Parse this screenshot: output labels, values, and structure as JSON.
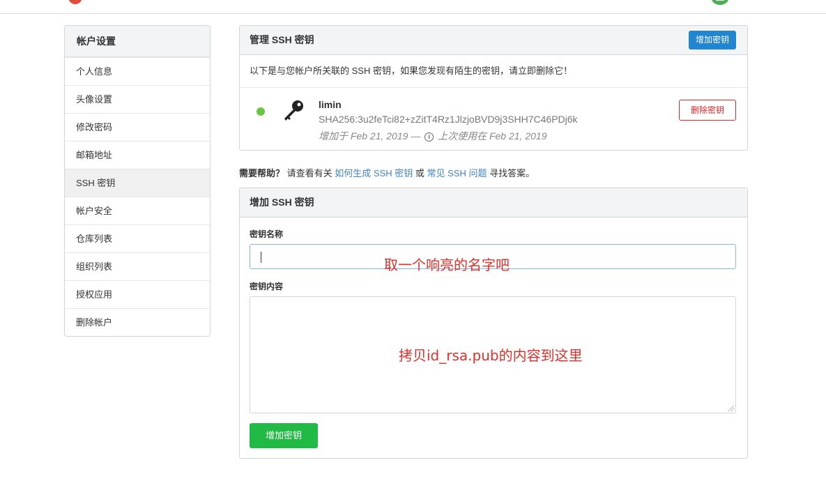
{
  "sidebar": {
    "title": "帐户设置",
    "items": [
      {
        "label": "个人信息"
      },
      {
        "label": "头像设置"
      },
      {
        "label": "修改密码"
      },
      {
        "label": "邮箱地址"
      },
      {
        "label": "SSH 密钥",
        "active": true
      },
      {
        "label": "帐户安全"
      },
      {
        "label": "仓库列表"
      },
      {
        "label": "组织列表"
      },
      {
        "label": "授权应用"
      },
      {
        "label": "删除帐户"
      }
    ]
  },
  "manage": {
    "title": "管理 SSH 密钥",
    "add_button": "增加密钥",
    "notice": "以下是与您帐户所关联的 SSH 密钥，如果您发现有陌生的密钥，请立即删除它！",
    "key": {
      "status_color": "#6cc644",
      "icon": "key-icon",
      "name": "limin",
      "fingerprint": "SHA256:3u2feTci82+zZitT4Rz1JlzjoBVD9j3SHH7C46PDj6k",
      "added": "增加于 Feb 21, 2019 —",
      "last_used": "上次使用在 Feb 21, 2019",
      "delete_button": "删除密钥"
    }
  },
  "help": {
    "lead": "需要帮助？",
    "text1": "请查看有关",
    "link1": "如何生成 SSH 密钥",
    "text2": "或",
    "link2": "常见 SSH 问题",
    "text3": "寻找答案。"
  },
  "add_form": {
    "title": "增加 SSH 密钥",
    "name_label": "密钥名称",
    "name_value": "",
    "content_label": "密钥内容",
    "content_value": "",
    "submit": "增加密钥"
  },
  "annotations": {
    "name_hint": "取一个响亮的名字吧",
    "content_hint": "拷贝id_rsa.pub的内容到这里",
    "color": "#e0302a"
  },
  "colors": {
    "primary": "#2185d0",
    "danger": "#db2828",
    "success": "#21ba45",
    "link": "#4183c4"
  }
}
